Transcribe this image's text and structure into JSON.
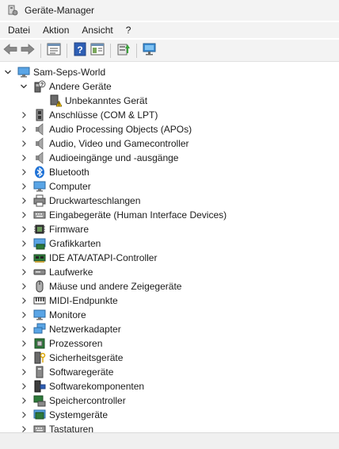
{
  "window": {
    "title": "Geräte-Manager"
  },
  "menu": [
    "Datei",
    "Aktion",
    "Ansicht",
    "?"
  ],
  "toolbar": {
    "buttons": [
      "back-icon",
      "forward-icon",
      "properties-view-icon",
      "help-icon",
      "show-hidden-icon",
      "update-driver-icon",
      "scan-hardware-icon"
    ]
  },
  "tree": {
    "root": "Sam-Seps-World",
    "other_devices": "Andere Geräte",
    "unknown_device": "Unbekanntes Gerät",
    "categories": [
      "Anschlüsse (COM & LPT)",
      "Audio Processing Objects (APOs)",
      "Audio, Video und Gamecontroller",
      "Audioeingänge und -ausgänge",
      "Bluetooth",
      "Computer",
      "Druckwarteschlangen",
      "Eingabegeräte (Human Interface Devices)",
      "Firmware",
      "Grafikkarten",
      "IDE ATA/ATAPI-Controller",
      "Laufwerke",
      "Mäuse und andere Zeigegeräte",
      "MIDI-Endpunkte",
      "Monitore",
      "Netzwerkadapter",
      "Prozessoren",
      "Sicherheitsgeräte",
      "Softwaregeräte",
      "Softwarekomponenten",
      "Speichercontroller",
      "Systemgeräte",
      "Tastaturen"
    ]
  }
}
